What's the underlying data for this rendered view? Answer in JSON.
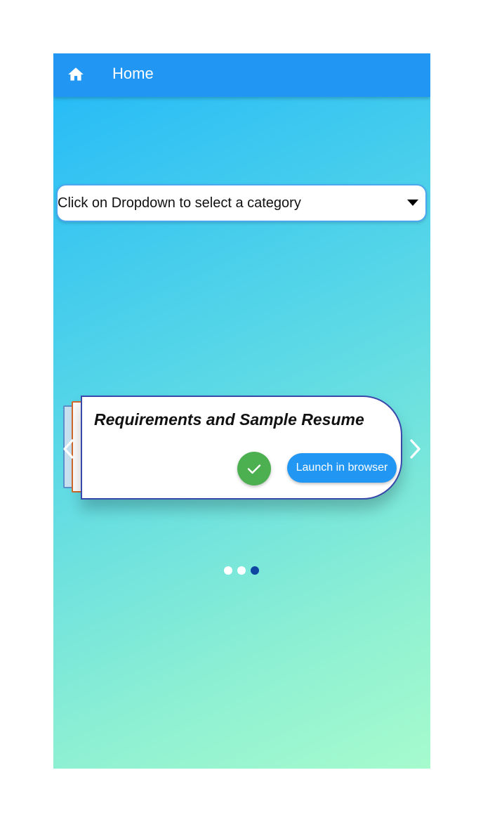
{
  "appbar": {
    "title": "Home",
    "icon": "home-icon",
    "color": "#2196f3"
  },
  "dropdown": {
    "hint": "Click on Dropdown to select a category",
    "icon": "dropdown-arrow-icon"
  },
  "carousel": {
    "card": {
      "title": "Requirements and Sample Resume",
      "check_icon": "check-icon",
      "launch_label": "Launch in browser"
    },
    "prev_icon": "chevron-left-icon",
    "next_icon": "chevron-right-icon",
    "page_count": 3,
    "active_page": 3
  },
  "colors": {
    "accent": "#2196f3",
    "check": "#4caf50",
    "card_border": "#3949ab",
    "dot_active": "#0d47a1",
    "gradient_top": "#22b9f8",
    "gradient_bottom": "#a6fbcd"
  }
}
